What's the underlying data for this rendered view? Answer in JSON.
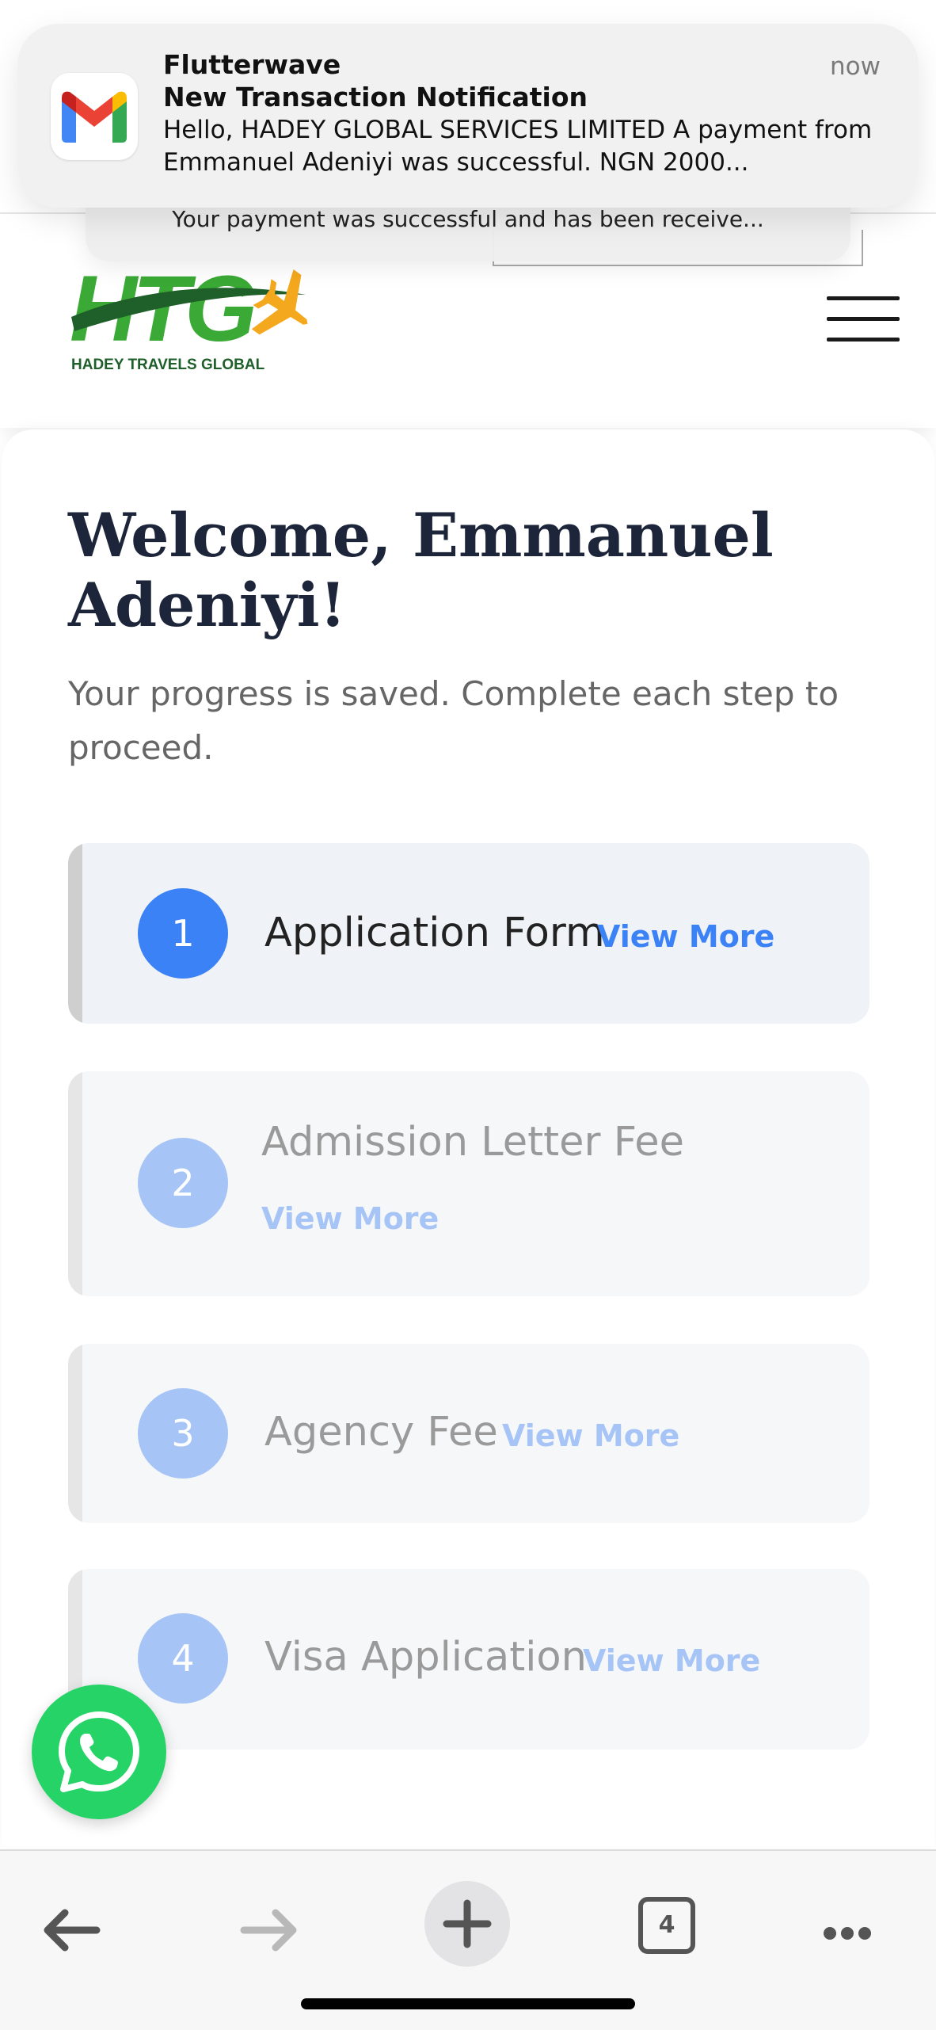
{
  "notification": {
    "app_name": "Flutterwave",
    "time": "now",
    "title": "New Transaction Notification",
    "body": "Hello, HADEY GLOBAL SERVICES LIMITED A payment from Emmanuel Adeniyi was successful. NGN 2000...",
    "stacked_preview": "Your payment was successful and has been receive...",
    "icon": "gmail-icon"
  },
  "header": {
    "logo_wordmark": "HTG",
    "logo_tagline": "HADEY TRAVELS GLOBAL",
    "menu_icon": "hamburger-icon"
  },
  "main": {
    "welcome": "Welcome, Emmanuel Adeniyi!",
    "subtitle": "Your progress is saved. Complete each step to proceed.",
    "steps": [
      {
        "number": "1",
        "title": "Application Form",
        "link": "View More",
        "active": true
      },
      {
        "number": "2",
        "title": "Admission Letter Fee",
        "link": "View More",
        "active": false
      },
      {
        "number": "3",
        "title": "Agency Fee",
        "link": "View More",
        "active": false
      },
      {
        "number": "4",
        "title": "Visa Application",
        "link": "View More",
        "active": false
      }
    ]
  },
  "floating": {
    "whatsapp_icon": "whatsapp-icon"
  },
  "toolbar": {
    "back_icon": "back-arrow-icon",
    "forward_icon": "forward-arrow-icon",
    "new_tab_icon": "plus-icon",
    "tab_count": "4",
    "more_icon": "more-dots-icon"
  },
  "colors": {
    "accent_blue": "#3b82f6",
    "inactive_blue": "#a6c4f6",
    "heading_navy": "#1c2539",
    "logo_green": "#3aa935",
    "logo_dark_green": "#1f5f2a",
    "logo_orange": "#f4a81d",
    "whatsapp_green": "#25d366"
  }
}
